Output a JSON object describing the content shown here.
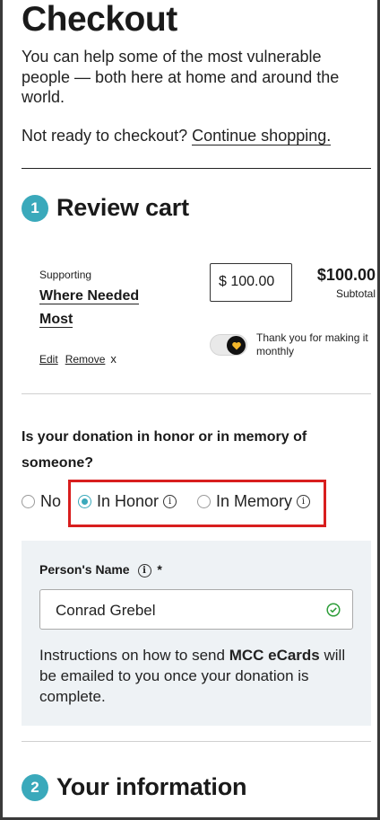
{
  "header": {
    "title": "Checkout",
    "intro": "You can help some of the most vulnerable people — both here at home and around the world.",
    "not_ready_text": "Not ready to checkout?",
    "continue_link": "Continue shopping."
  },
  "review": {
    "step_number": "1",
    "title": "Review cart",
    "supporting_label": "Supporting",
    "fund_name": "Where Needed Most",
    "edit_label": "Edit",
    "remove_label": "Remove",
    "remove_x": "x",
    "amount_value": "$ 100.00",
    "total": "$100.00",
    "subtotal_label": "Subtotal",
    "monthly_label": "Thank you for making it monthly",
    "monthly_on": true
  },
  "honor": {
    "question": "Is your donation in honor or in memory of someone?",
    "options": [
      {
        "label": "No",
        "selected": false
      },
      {
        "label": "In Honor",
        "selected": true
      },
      {
        "label": "In Memory",
        "selected": false
      }
    ],
    "person_label": "Person's Name",
    "required_mark": "*",
    "person_value": "Conrad Grebel",
    "note_prefix": "Instructions on how to send ",
    "note_bold": "MCC eCards",
    "note_suffix": " will be emailed to you once your donation is complete."
  },
  "info": {
    "step_number": "2",
    "title": "Your information"
  },
  "colors": {
    "accent": "#3aa9bb",
    "highlight": "#d81e1e",
    "panel": "#eef2f5",
    "success": "#2e9e3a",
    "heart": "#f2b62b"
  },
  "icons": {
    "info": "info-icon",
    "check": "check-circle-icon",
    "heart": "heart-icon"
  }
}
